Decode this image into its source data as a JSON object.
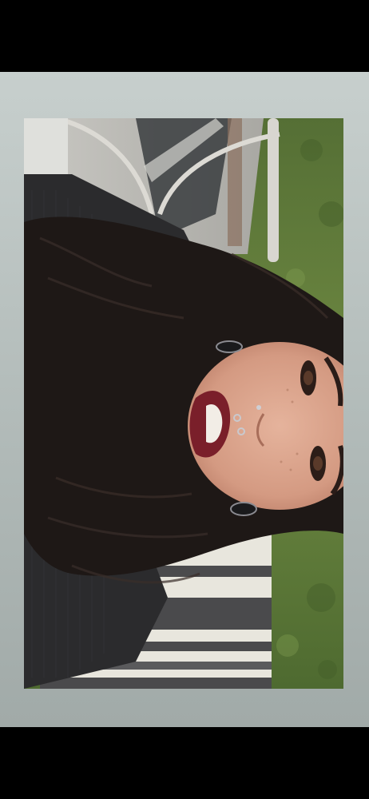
{
  "story": {
    "background_color": "#b8c0be",
    "photo": {
      "description_icon": "portrait-photo",
      "orientation": "rotated-90-counterclockwise"
    }
  },
  "colors": {
    "sweater": "#2b2b2d",
    "hair": "#1e1816",
    "skin": "#d9a58e",
    "lips": "#7a1f2a",
    "grass": "#5f7a3a",
    "stripe_light": "#e9e7df",
    "stripe_dark": "#4a4a4c",
    "railing": "#d8d6d0"
  }
}
